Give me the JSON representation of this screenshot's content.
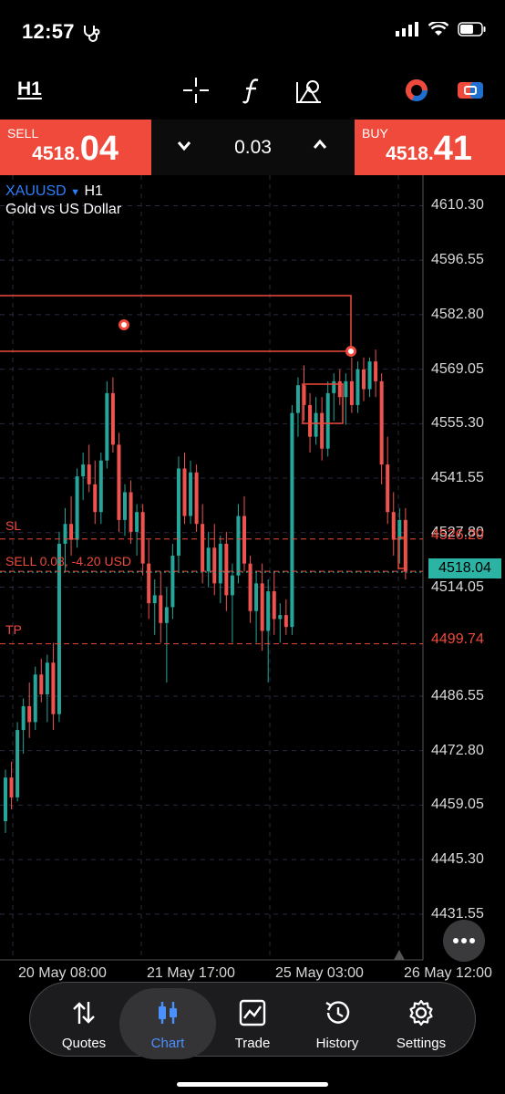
{
  "status_bar": {
    "time": "12:57"
  },
  "toolbar": {
    "timeframe": "H1"
  },
  "trade": {
    "sell_label": "SELL",
    "sell_price_prefix": "4518.",
    "sell_price_big": "04",
    "buy_label": "BUY",
    "buy_price_prefix": "4518.",
    "buy_price_big": "41",
    "lot_size": "0.03"
  },
  "chart": {
    "symbol": "XAUUSD",
    "timeframe": "H1",
    "description": "Gold vs US Dollar",
    "price_axis": [
      "4610.30",
      "4596.55",
      "4582.80",
      "4569.05",
      "4555.30",
      "4541.55",
      "4527.80",
      "4514.05",
      "4486.55",
      "4472.80",
      "4459.05",
      "4445.30",
      "4431.55"
    ],
    "sl_label": "SL",
    "sl_price": "4526.20",
    "position_label": "SELL 0.03, -4.20 USD",
    "current_price": "4518.04",
    "tp_label": "TP",
    "tp_price": "4499.74",
    "time_axis": [
      "20 May 08:00",
      "21 May 17:00",
      "25 May 03:00",
      "26 May 12:00"
    ],
    "colors": {
      "up": "#26a69a",
      "down": "#ef5350",
      "sl_tp": "#ef4a3b",
      "accent": "#2d7ff9"
    }
  },
  "chart_data": {
    "type": "candlestick",
    "symbol": "XAUUSD",
    "timeframe": "H1",
    "ylim": [
      4420,
      4618
    ],
    "categories": [
      "20 May 08:00",
      "21 May 17:00",
      "25 May 03:00",
      "26 May 12:00"
    ],
    "candles": [
      [
        4455,
        4468,
        4452,
        4466
      ],
      [
        4466,
        4470,
        4458,
        4461
      ],
      [
        4461,
        4480,
        4460,
        4478
      ],
      [
        4478,
        4486,
        4472,
        4484
      ],
      [
        4484,
        4490,
        4476,
        4480
      ],
      [
        4480,
        4494,
        4478,
        4492
      ],
      [
        4492,
        4496,
        4485,
        4487
      ],
      [
        4487,
        4497,
        4480,
        4495
      ],
      [
        4495,
        4500,
        4478,
        4482
      ],
      [
        4482,
        4528,
        4480,
        4525
      ],
      [
        4525,
        4534,
        4518,
        4530
      ],
      [
        4530,
        4537,
        4522,
        4526
      ],
      [
        4526,
        4544,
        4524,
        4542
      ],
      [
        4542,
        4548,
        4536,
        4545
      ],
      [
        4545,
        4550,
        4538,
        4540
      ],
      [
        4540,
        4546,
        4530,
        4533
      ],
      [
        4533,
        4548,
        4530,
        4546
      ],
      [
        4546,
        4566,
        4544,
        4563
      ],
      [
        4563,
        4567,
        4548,
        4550
      ],
      [
        4550,
        4553,
        4528,
        4531
      ],
      [
        4531,
        4540,
        4527,
        4538
      ],
      [
        4538,
        4541,
        4525,
        4528
      ],
      [
        4528,
        4535,
        4522,
        4533
      ],
      [
        4533,
        4535,
        4517,
        4520
      ],
      [
        4520,
        4526,
        4506,
        4510
      ],
      [
        4510,
        4516,
        4502,
        4512
      ],
      [
        4512,
        4518,
        4500,
        4505
      ],
      [
        4505,
        4514,
        4490,
        4509
      ],
      [
        4509,
        4525,
        4506,
        4522
      ],
      [
        4522,
        4547,
        4518,
        4544
      ],
      [
        4544,
        4548,
        4530,
        4532
      ],
      [
        4532,
        4546,
        4530,
        4543
      ],
      [
        4543,
        4545,
        4528,
        4530
      ],
      [
        4530,
        4535,
        4515,
        4518
      ],
      [
        4518,
        4528,
        4514,
        4524
      ],
      [
        4524,
        4530,
        4512,
        4515
      ],
      [
        4515,
        4527,
        4510,
        4525
      ],
      [
        4525,
        4528,
        4508,
        4512
      ],
      [
        4512,
        4520,
        4500,
        4517
      ],
      [
        4517,
        4535,
        4515,
        4532
      ],
      [
        4532,
        4537,
        4518,
        4520
      ],
      [
        4520,
        4522,
        4505,
        4508
      ],
      [
        4508,
        4518,
        4500,
        4515
      ],
      [
        4515,
        4520,
        4498,
        4503
      ],
      [
        4503,
        4516,
        4490,
        4513
      ],
      [
        4513,
        4518,
        4502,
        4506
      ],
      [
        4506,
        4510,
        4500,
        4507
      ],
      [
        4507,
        4511,
        4502,
        4504
      ],
      [
        4504,
        4560,
        4502,
        4558
      ],
      [
        4558,
        4567,
        4552,
        4565
      ],
      [
        4565,
        4570,
        4556,
        4560
      ],
      [
        4560,
        4563,
        4548,
        4552
      ],
      [
        4552,
        4562,
        4550,
        4558
      ],
      [
        4558,
        4562,
        4546,
        4549
      ],
      [
        4549,
        4566,
        4547,
        4563
      ],
      [
        4563,
        4568,
        4556,
        4566
      ],
      [
        4566,
        4569,
        4560,
        4562
      ],
      [
        4562,
        4568,
        4555,
        4566
      ],
      [
        4566,
        4572,
        4558,
        4560
      ],
      [
        4560,
        4571,
        4558,
        4569
      ],
      [
        4569,
        4572,
        4561,
        4564
      ],
      [
        4564,
        4572,
        4562,
        4571
      ],
      [
        4571,
        4574,
        4562,
        4566
      ],
      [
        4566,
        4568,
        4540,
        4545
      ],
      [
        4545,
        4552,
        4530,
        4533
      ],
      [
        4533,
        4538,
        4522,
        4526
      ],
      [
        4526,
        4534,
        4520,
        4531
      ],
      [
        4531,
        4534,
        4516,
        4518
      ]
    ]
  }
}
